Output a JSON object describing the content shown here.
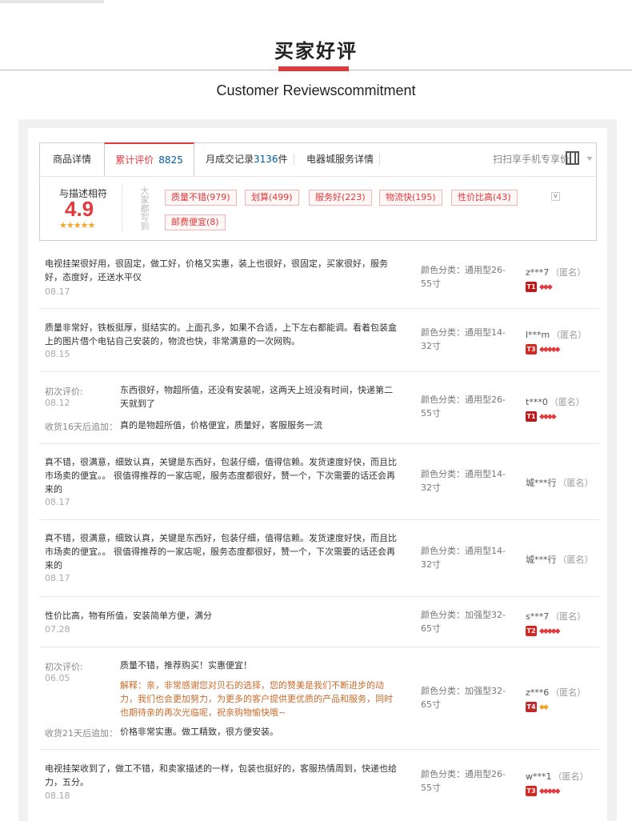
{
  "header": {
    "title": "买家好评",
    "subtitle": "Customer Reviewscommitment"
  },
  "tabs": {
    "product_detail": "商品详情",
    "cumulative_label": "累计评价",
    "cumulative_count": "8825",
    "monthly_prefix": "月成交记录",
    "monthly_count": "3136",
    "monthly_suffix": "件",
    "service_detail": "电器城服务详情",
    "scan_text": "扫扫享手机专享价"
  },
  "summary": {
    "rate_label": "与描述相符",
    "score": "4.9",
    "stars": "★★★★★",
    "vertical_label": "大家都写到",
    "tags": [
      "质量不错(979)",
      "划算(499)",
      "服务好(223)",
      "物流快(195)",
      "性价比高(43)",
      "邮费便宜(8)"
    ],
    "toggle": "v"
  },
  "reviews": [
    {
      "text": "电视挂架很好用，很固定，做工好，价格又实惠，装上也很好，很固定，买家很好，服务好，态度好，还送水平仪",
      "date": "08.17",
      "spec": "颜色分类：通用型26-55寸",
      "user": "z***7",
      "anon": "（匿名）",
      "level": "T1",
      "gems": "◆◆◆"
    },
    {
      "text": "质量非常好，铁板挺厚，挺结实的。上面孔多，如果不合适，上下左右都能调。看着包装盒上的图片借个电钻自己安装的，物流也快，非常满意的一次网购。",
      "date": "08.15",
      "spec": "颜色分类：通用型14-32寸",
      "user": "l***m",
      "anon": "（匿名）",
      "level": "T3",
      "gems": "◆◆◆◆◆"
    },
    {
      "initial_label": "初次评价:",
      "text": "东西很好，物超所值，还没有安装呢，这两天上班没有时间，快递第二天就到了",
      "date": "08.12",
      "followup_label": "收货16天后追加：",
      "followup": "真的是物超所值，价格便宜，质量好，客服服务一流",
      "spec": "颜色分类：通用型26-55寸",
      "user": "t***0",
      "anon": "（匿名）",
      "level": "T1",
      "gems": "◆◆◆◆"
    },
    {
      "text": "真不错，很满意，细致认真，关键是东西好，包装仔细，值得信赖。发货速度好快，而且比市场卖的便宜。。 很值得推荐的一家店呢，服务态度都很好，赞一个，下次需要的话还会再来的",
      "date": "08.17",
      "spec": "颜色分类：通用型14-32寸",
      "user": "城***行",
      "anon": "（匿名）"
    },
    {
      "text": "真不错，很满意，细致认真，关键是东西好，包装仔细，值得信赖。发货速度好快，而且比市场卖的便宜。。 很值得推荐的一家店呢，服务态度都很好，赞一个，下次需要的话还会再来的",
      "date": "08.17",
      "spec": "颜色分类：通用型14-32寸",
      "user": "城***行",
      "anon": "（匿名）"
    },
    {
      "text": "性价比高，物有所值，安装简单方便，满分",
      "date": "07.28",
      "spec": "颜色分类：加强型32-65寸",
      "user": "s***7",
      "anon": "（匿名）",
      "level": "T2",
      "gems": "◆◆◆◆◆"
    },
    {
      "initial_label": "初次评价:",
      "text": "质量不错，推荐购买！实惠便宜！",
      "date": "06.05",
      "reply": "解释：亲，非常感谢您对贝石的选择，您的赞美是我们不断进步的动力，我们也会更加努力，为更多的客户提供更优质的产品和服务，同时也期待亲的再次光临呢，祝亲购物愉快哦~",
      "followup_label": "收货21天后追加：",
      "followup": "价格非常实惠。做工精致，很方便安装。",
      "spec": "颜色分类：加强型32-65寸",
      "user": "z***6",
      "anon": "（匿名）",
      "level": "T4",
      "gems": "◆◆"
    },
    {
      "text": "电视挂架收到了，做工不错，和卖家描述的一样，包装也挺好的，客服热情周到，快递也给力，五分。",
      "date": "08.18",
      "spec": "颜色分类：通用型26-55寸",
      "user": "w***1",
      "anon": "（匿名）",
      "level": "T3",
      "gems": "◆◆◆◆◆"
    }
  ],
  "colors": {
    "accent": "#e4393c",
    "link_blue": "#005aa0",
    "star": "#f3a52c"
  }
}
